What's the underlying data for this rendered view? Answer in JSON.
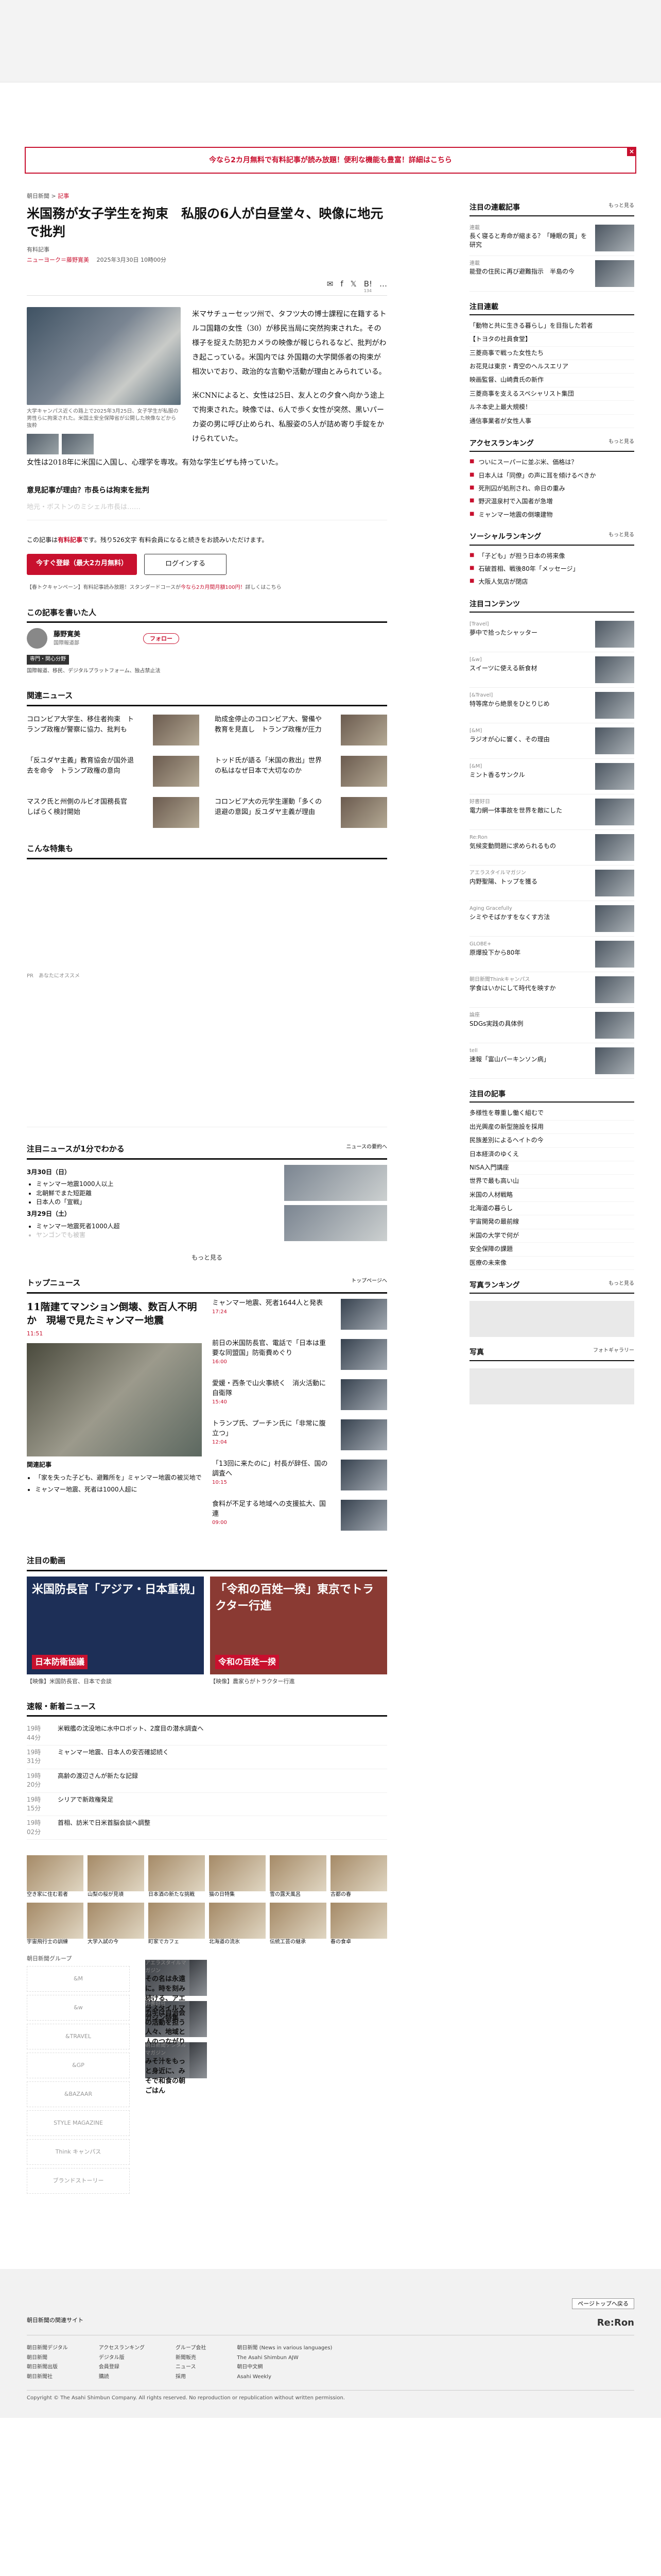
{
  "banner": {
    "text": "今なら2カ月無料で有料記事が読み放題！便利な機能も豊富！詳細はこちら",
    "close": "×"
  },
  "article": {
    "crumb_section": "朝日新聞",
    "crumb_tag": "記事",
    "title": "米国務が女子学生を拘束　私服の6人が白昼堂々、映像に地元で批判",
    "paid": "有料記事",
    "byline_name": "ニューヨーク＝藤野寛美",
    "byline_date": "2025年3月30日 10時00分",
    "share": [
      "✉",
      "f",
      "𝕏",
      "B!",
      "…"
    ],
    "share_count": "134",
    "caption": "大学キャンパス近くの路上で2025年3月25日、女子学生が私服の男性らに拘束された。米国土安全保障省が公開した映像などから抜粋",
    "paragraphs": [
      "米マサチューセッツ州で、タフツ大の博士課程に在籍するトルコ国籍の女性（30）が移民当局に突然拘束された。その様子を捉えた防犯カメラの映像が報じられるなど、批判がわき起こっている。米国内では 外国籍の大学関係者の拘束が相次いでおり、政治的な言動や活動が理由とみられている。",
      "米CNNによると、女性は25日、友人との夕食へ向かう途上で拘束された。映像では、6人で歩く女性が突然、黒いパーカ姿の男に呼び止められ、私服姿の5人が詰め寄り手錠をかけられていた。",
      "女性は2018年に米国に入国し、心理学を専攻。有効な学生ビザも持っていた。"
    ]
  },
  "midhead": "意見記事が理由？市長らは拘束を批判",
  "fade": "地元・ボストンのミシェル市長は……",
  "paywall": {
    "text1": "この記事は",
    "text2": "有料記事",
    "text3": "です。残り526文字 有料会員になると続きをお読みいただけます。",
    "subscribe": "今すぐ登録（最大2カ月無料）",
    "login": "ログインする",
    "note": "【春トクキャンペーン】有料記事読み放題！スタンダードコースが",
    "note_red": "今なら2カ月間月額100円！",
    "note_end": "詳しくはこちら"
  },
  "author_sec": "この記事を書いた人",
  "author": {
    "name": "藤野寛美",
    "role": "国際報道部",
    "follow": "フォロー",
    "tags": [
      "専門・関心分野"
    ],
    "topics": "国際報道、移民、デジタルプラットフォーム、独占禁止法"
  },
  "related_sec": "関連ニュース",
  "related": [
    "コロンビア大学生、移住者拘束　トランプ政権が警察に協力、批判も",
    "コロンビア大の元学生運動「多くの退避の意図」反ユダヤ主義が理由",
    "「反ユダヤ主義」教育協会が国外退去を命令　トランプ政権の意向",
    "助成金停止のコロンビア大、警備や教育を見直し　トランプ政権が圧力",
    "マスク氏と州側のルビオ国務長官　しばらく検討開始",
    "トッド氏が語る「米国の救出」世界の私はなぜ日本で大切なのか"
  ],
  "feature_sec": "こんな特集も",
  "feature_note": "PR　あなたにオススメ",
  "dated": {
    "sec": "注目ニュースが1分でわかる",
    "link": "ニュースの要約へ",
    "d1": "3月30日（日）",
    "items1": [
      "ミャンマー地震1000人以上",
      "北朝鮮でまた短距離",
      "日本人の「宣戦」"
    ],
    "d2": "3月29日（土）",
    "items2": [
      "ミャンマー地震死者1000人超",
      "ヤンゴンでも被害"
    ],
    "more": "もっと見る"
  },
  "top": {
    "sec": "トップニュース",
    "link": "トップページへ",
    "lead_title": "11階建てマンション倒壊、数百人不明か　現場で見たミャンマー地震",
    "lead_time": "11:51",
    "related_label": "関連記事",
    "lead_list": [
      "「家を失った子ども、避難所を」ミャンマー地震の被災地で",
      "ミャンマー地震、死者は1000人超に"
    ],
    "items": [
      {
        "t": "ミャンマー地震、死者1644人と発表",
        "time": "17:24"
      },
      {
        "t": "前日の米国防長官、電話で「日本は重要な同盟国」防衛費めぐり",
        "time": "16:00"
      },
      {
        "t": "愛媛・西条で山火事続く　消火活動に自衛隊",
        "time": "15:40"
      },
      {
        "t": "トランプ氏、プーチン氏に「非常に腹立つ」",
        "time": "12:04"
      },
      {
        "t": "「13回に来たのに」村長が辞任、国の調査へ",
        "time": "10:15"
      },
      {
        "t": "食料が不足する地域への支援拡大、国連",
        "time": "09:00"
      }
    ]
  },
  "video_sec": "注目の動画",
  "videos": [
    {
      "title": "米国防長官「アジア・日本重視」",
      "tag": "日本防衛協議",
      "cap": "【映像】米国防長官、日本で会談"
    },
    {
      "title": "「令和の百姓一揆」東京でトラクター行進",
      "tag": "令和の百姓一揆",
      "cap": "【映像】農家らがトラクター行進"
    }
  ],
  "breaking_sec": "速報・新着ニュース",
  "breaking": [
    {
      "time": "19時44分",
      "t": "米戦艦の沈没地に水中ロボット、2度目の潜水調査へ"
    },
    {
      "time": "19時31分",
      "t": "ミャンマー地震、日本人の安否確認続く"
    },
    {
      "time": "19時20分",
      "t": "高齢の渡辺さんが新たな記録"
    },
    {
      "time": "19時15分",
      "t": "シリアで新政権発足"
    },
    {
      "time": "19時02分",
      "t": "首相、訪米で日米首脳会談へ調整"
    }
  ],
  "gallery": [
    "空き家に住む若者",
    "山梨の桜が見頃",
    "日本酒の新たな挑戦",
    "猫の日特集",
    "雪の露天風呂",
    "古都の春",
    "宇宙飛行士の訓練",
    "大学入試の今",
    "町家でカフェ",
    "北海道の流氷",
    "伝統工芸の継承",
    "春の食卓"
  ],
  "brand_sec": "朝日新聞グループ",
  "brands": [
    "&M",
    "&w",
    "&TRAVEL",
    "&GP",
    "&BAZAAR",
    "STYLE MAGAZINE",
    "Think キャンパス",
    "ブランドストーリー"
  ],
  "promo": [
    {
      "label": "アエラスタイルマガジン",
      "t": "その名は永遠に。時を刻み続ける、アエラスタイルマガジン特集"
    },
    {
      "label": "好書好日",
      "t": "カギは自治会の活動を担う人々、地域と人のつながり"
    },
    {
      "label": "朝日新聞デジタルマガジン",
      "t": "みそ汁をもっと身近に、みそで和食の朝ごはん"
    }
  ],
  "side": {
    "trend_sec": "注目の連載記事",
    "trend_more": "もっと見る",
    "trends": [
      {
        "s": "連載",
        "t": "長く寝ると寿命が縮まる？「睡眠の質」を研究"
      },
      {
        "s": "連載",
        "t": "能登の住民に再び避難指示　半島の今"
      }
    ],
    "serial_sec": "注目連載",
    "serials": [
      "「動物と共に生きる暮らし」を目指した若者",
      "【トヨタの社員食堂】",
      "三菱商事で戦った女性たち",
      "お花見は東京・青空のヘルスエリア",
      "映画監督、山崎貴氏の新作",
      "三菱商事を支えるスペシャリスト集団",
      "ルネ本史上最大規模！",
      "通信事業者が女性人事"
    ],
    "access_sec": "アクセスランキング",
    "access_more": "もっと見る",
    "access": [
      "ついにスーパーに並ぶ米、価格は？",
      "日本人は「同僚」の声に耳を傾けるべきか",
      "死刑囚が処刑され、命日の重み",
      "野沢温泉村で入国者が急増",
      "ミャンマー地震の倒壊建物"
    ],
    "social_sec": "ソーシャルランキング",
    "social_more": "もっと見る",
    "social": [
      "「子ども」が担う日本の将来像",
      "石破首相、戦後80年「メッセージ」",
      "大阪人気店が閉店"
    ],
    "orig_sec": "注目コンテンツ",
    "orig": [
      {
        "s": "[Travel]",
        "t": "夢中で拾ったシャッター　"
      },
      {
        "s": "[&w]",
        "t": "スイーツに使える新食材"
      },
      {
        "s": "[&Travel]",
        "t": "特等席から絶景をひとりじめ"
      },
      {
        "s": "[&M]",
        "t": "ラジオが心に響く、その理由"
      },
      {
        "s": "[&M]",
        "t": "ミント香るサンクル"
      },
      {
        "s": "好書好日",
        "t": "電力網一体事故を世界を敵にした"
      },
      {
        "s": "Re:Ron",
        "t": "気候変動問題に求められるもの"
      },
      {
        "s": "アエラスタイルマガジン",
        "t": "内野聖陽、トップを獲る"
      },
      {
        "s": "Aging Gracefully",
        "t": "シミやそばかすをなくす方法"
      },
      {
        "s": "GLOBE+",
        "t": "原爆投下から80年"
      },
      {
        "s": "朝日新聞Thinkキャンパス",
        "t": "学食はいかにして時代を映すか"
      },
      {
        "s": "論座",
        "t": "SDGs実践の具体例"
      },
      {
        "s": "tell",
        "t": "速報「富山パーキンソン病」"
      }
    ],
    "list_sec": "注目の記事",
    "list": [
      "多様性を尊重し働く組むで",
      "出光興産の新型施設を採用",
      "民族差別によるヘイトの今",
      "日本経済のゆくえ",
      "NISA入門講座",
      "世界で最も高い山",
      "米国の人材戦略",
      "北海道の暮らし",
      "宇宙開発の最前線",
      "米国の大学で何が",
      "安全保障の課題",
      "医療の未来像"
    ],
    "pop_sec": "写真ランキング",
    "pop_more": "もっと見る",
    "photo_sec": "写真",
    "photo_more": "フォトギャラリー"
  },
  "footer": {
    "pagetop": "ページトップへ戻る",
    "brand": "Re:Ron",
    "site": "朝日新聞の関連サイト",
    "cols": [
      [
        "朝日新聞デジタル",
        "朝日新聞",
        "朝日新聞出版",
        "朝日新聞社"
      ],
      [
        "アクセスランキング",
        "デジタル版",
        "会員登録",
        "購読"
      ],
      [
        "グループ会社",
        "新聞販売",
        "ニュース",
        "採用"
      ],
      [
        "朝日新聞 (News in various languages)",
        "The Asahi Shimbun AJW",
        "朝日中文網",
        "Asahi Weekly"
      ]
    ],
    "bottom": "Copyright © The Asahi Shimbun Company. All rights reserved. No reproduction or republication without written permission."
  }
}
